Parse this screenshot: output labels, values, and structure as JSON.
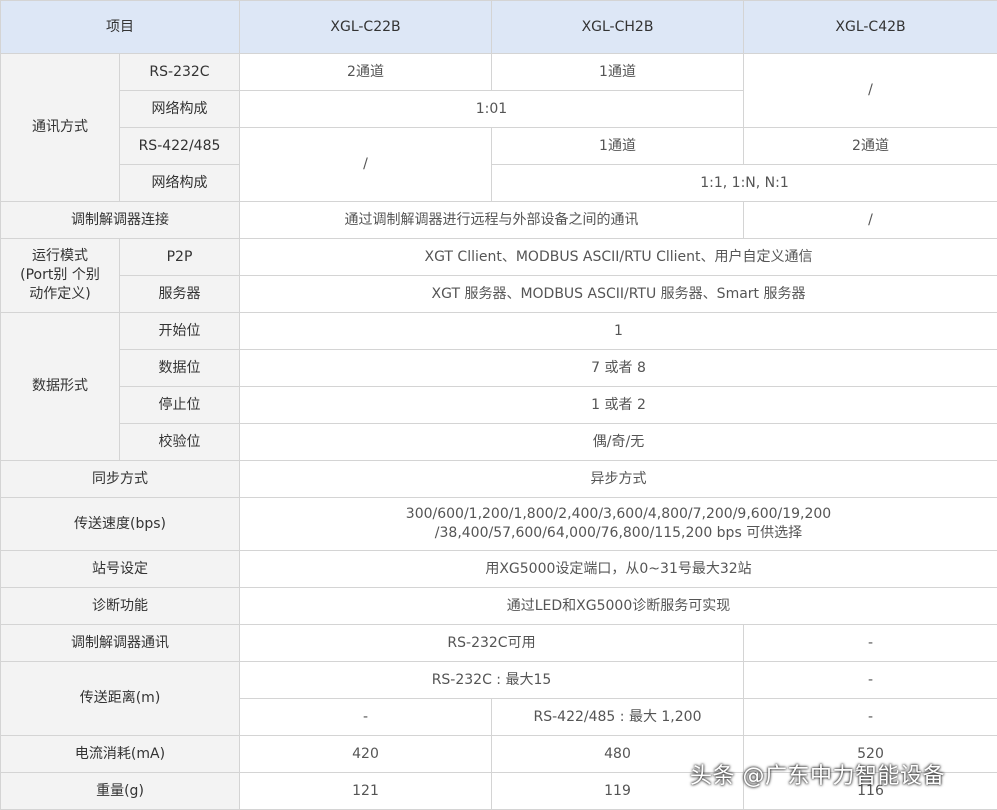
{
  "header": {
    "item": "项目",
    "models": [
      "XGL-C22B",
      "XGL-CH2B",
      "XGL-C42B"
    ]
  },
  "comm": {
    "label": "通讯方式",
    "rs232_label": "RS-232C",
    "rs232_c22b": "2通道",
    "rs232_ch2b": "1通道",
    "rs232_c42b": "/",
    "net_label": "网络构成",
    "net_232": "1:01",
    "rs422_label": "RS-422/485",
    "rs422_c22b": "/",
    "rs422_ch2b": "1通道",
    "rs422_c42b": "2通道",
    "net_422": "1:1,  1:N, N:1"
  },
  "modem_connect": {
    "label": "调制解调器连接",
    "value": "通过调制解调器进行远程与外部设备之间的通讯",
    "c42b": "/"
  },
  "mode": {
    "label_line1": "运行模式",
    "label_line2": "(Port别 个别",
    "label_line3": "动作定义)",
    "p2p_label": "P2P",
    "p2p_value": "XGT Cllient、MODBUS ASCII/RTU Cllient、用户自定义通信",
    "server_label": "服务器",
    "server_value": "XGT 服务器、MODBUS ASCII/RTU 服务器、Smart 服务器"
  },
  "data_format": {
    "label": "数据形式",
    "start_label": "开始位",
    "start_value": "1",
    "data_label": "数据位",
    "data_value": "7 或者 8",
    "stop_label": "停止位",
    "stop_value": "1 或者 2",
    "parity_label": "校验位",
    "parity_value": "偶/奇/无"
  },
  "sync": {
    "label": "同步方式",
    "value": "异步方式"
  },
  "speed": {
    "label": "传送速度(bps)",
    "line1": "300/600/1,200/1,800/2,400/3,600/4,800/7,200/9,600/19,200",
    "line2": "/38,400/57,600/64,000/76,800/115,200 bps 可供选择"
  },
  "station": {
    "label": "站号设定",
    "value": "用XG5000设定端口，从0~31号最大32站"
  },
  "diag": {
    "label": "诊断功能",
    "value": "通过LED和XG5000诊断服务可实现"
  },
  "modem_comm": {
    "label": "调制解调器通讯",
    "value": "RS-232C可用",
    "c42b": "-"
  },
  "distance": {
    "label": "传送距离(m)",
    "rs232_value": "RS-232C : 最大15",
    "rs232_c42b": "-",
    "c22b": "-",
    "rs422_value": "RS-422/485 : 最大 1,200",
    "rs422_c42b": "-"
  },
  "current": {
    "label": "电流消耗(mA)",
    "values": [
      "420",
      "480",
      "520"
    ]
  },
  "weight": {
    "label": "重量(g)",
    "values": [
      "121",
      "119",
      "116"
    ]
  },
  "watermark": "头条 @广东中力智能设备"
}
